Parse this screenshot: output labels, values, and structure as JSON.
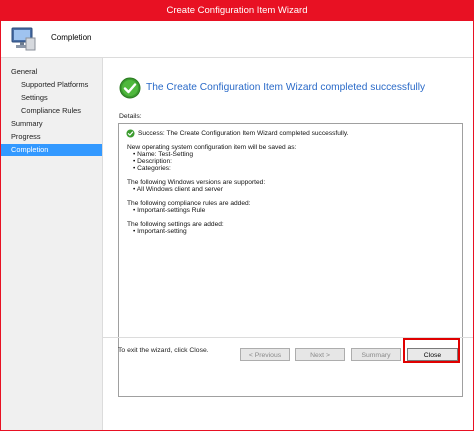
{
  "window": {
    "title": "Create Configuration Item Wizard",
    "accent_color": "#e81123"
  },
  "header": {
    "title": "Completion",
    "icon": "computer-icon"
  },
  "nav": {
    "items": [
      {
        "label": "General"
      },
      {
        "label": "Supported Platforms"
      },
      {
        "label": "Settings"
      },
      {
        "label": "Compliance Rules"
      },
      {
        "label": "Summary"
      },
      {
        "label": "Progress"
      },
      {
        "label": "Completion"
      }
    ],
    "active_index": 6,
    "active_color": "#3399ff"
  },
  "main": {
    "headline": "The Create Configuration Item Wizard completed successfully",
    "details_label": "Details:",
    "details_lines": [
      "Success: The Create Configuration Item Wizard completed successfully.",
      "New operating system configuration item will be saved as:",
      "• Name: Test-Setting",
      "• Description:",
      "• Categories:",
      "The following Windows versions are supported:",
      "• All Windows client and server",
      "The following compliance rules are added:",
      "• Important-settings Rule",
      "The following settings are added:",
      "• Important-setting"
    ],
    "exit_text": "To exit the wizard, click Close."
  },
  "buttons": {
    "previous": "< Previous",
    "next": "Next >",
    "summary": "Summary",
    "close": "Close"
  }
}
